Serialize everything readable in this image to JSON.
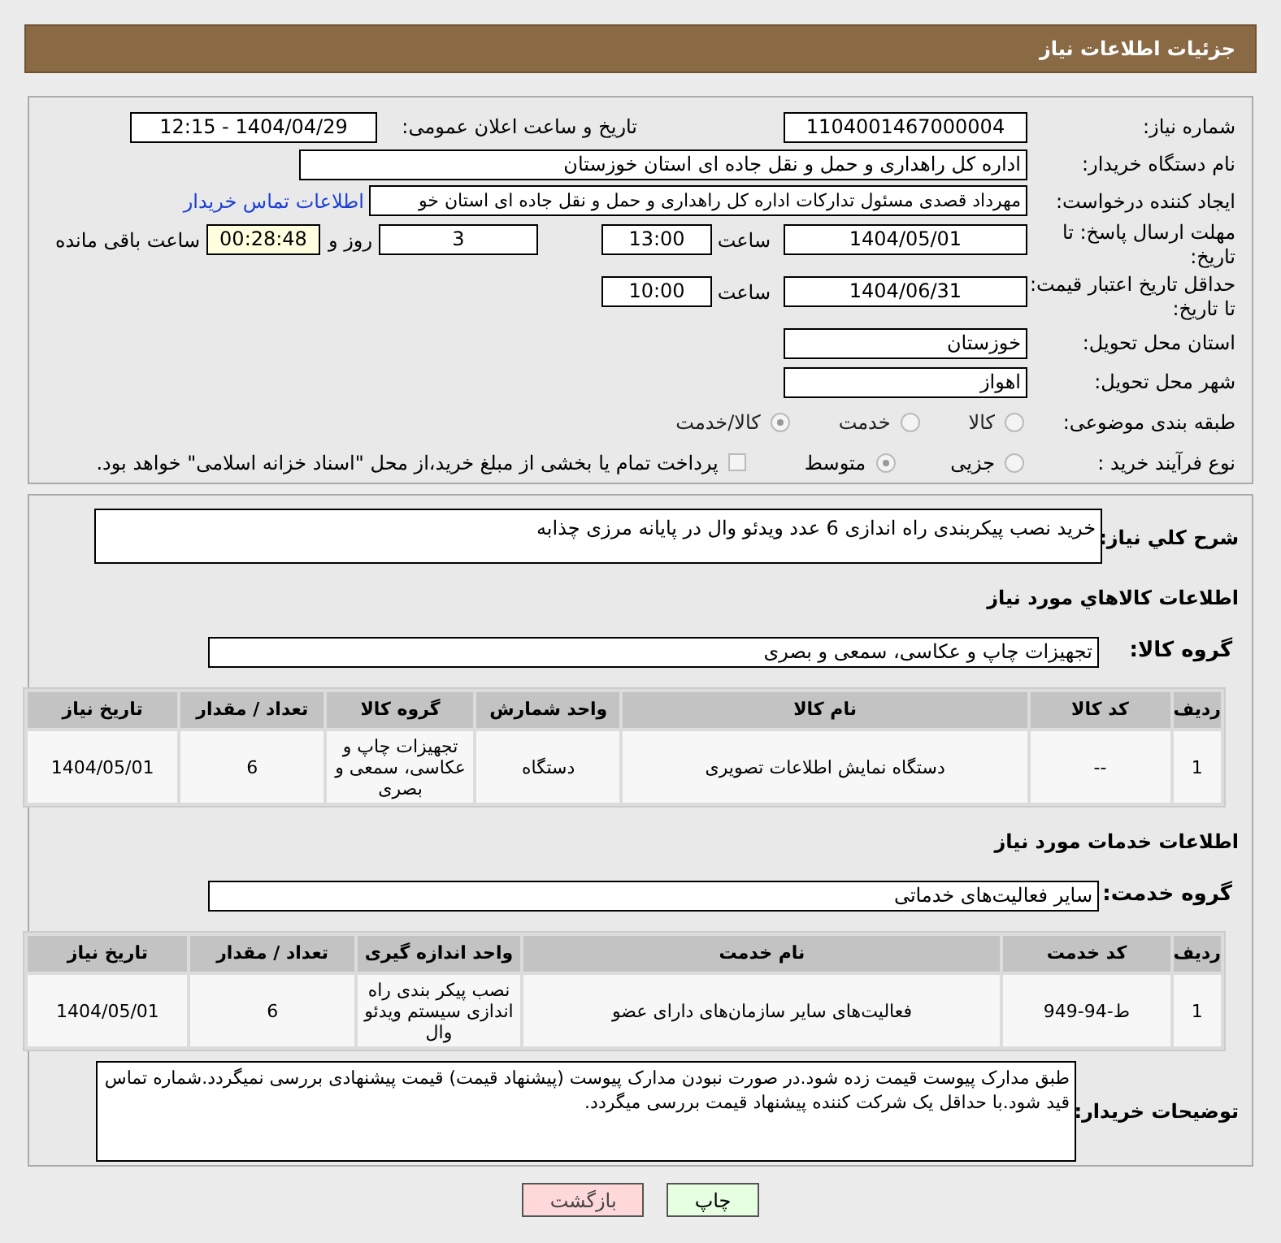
{
  "header": {
    "title": "جزئیات اطلاعات نیاز"
  },
  "need_number": {
    "label": "شماره نیاز:",
    "value": "1104001467000004"
  },
  "announce": {
    "label": "تاریخ و ساعت اعلان عمومی:",
    "value": "1404/04/29 - 12:15"
  },
  "buyer_org": {
    "label": "نام دستگاه خریدار:",
    "value": "اداره کل راهداری و حمل و نقل جاده ای استان خوزستان"
  },
  "creator": {
    "label": "ایجاد کننده درخواست:",
    "value": "مهرداد قصدی مسئول تدارکات اداره کل راهداری و حمل و نقل جاده ای استان خو",
    "link": "اطلاعات تماس خریدار"
  },
  "deadline": {
    "label": "مهلت ارسال پاسخ: تا تاریخ:",
    "date": "1404/05/01",
    "time_label": "ساعت",
    "time": "13:00",
    "days": "3",
    "days_label": "روز و",
    "remaining": "00:28:48",
    "remaining_label": "ساعت باقی مانده"
  },
  "validity": {
    "label": "حداقل تاریخ اعتبار قیمت: تا تاریخ:",
    "date": "1404/06/31",
    "time_label": "ساعت",
    "time": "10:00"
  },
  "province": {
    "label": "استان محل تحویل:",
    "value": "خوزستان"
  },
  "city": {
    "label": "شهر محل تحویل:",
    "value": "اهواز"
  },
  "category": {
    "label": "طبقه بندی موضوعی:",
    "options": [
      {
        "label": "کالا",
        "selected": false
      },
      {
        "label": "خدمت",
        "selected": false
      },
      {
        "label": "کالا/خدمت",
        "selected": true
      }
    ]
  },
  "purchase_type": {
    "label": "نوع فرآیند خرید :",
    "options": [
      {
        "label": "جزیی",
        "selected": false
      },
      {
        "label": "متوسط",
        "selected": true
      }
    ],
    "payment_checkbox": {
      "label": "پرداخت تمام یا بخشی از مبلغ خرید،از محل \"اسناد خزانه اسلامی\" خواهد بود.",
      "checked": false
    }
  },
  "description": {
    "label": "شرح كلي نياز:",
    "value": "خرید نصب پیکربندی راه اندازی 6 عدد ویدئو وال در پایانه مرزی چذابه"
  },
  "goods": {
    "heading": "اطلاعات کالاهاي مورد نياز",
    "group_label": "گروه کالا:",
    "group": "تجهیزات چاپ و عکاسی، سمعی و بصری",
    "columns": [
      "ردیف",
      "کد کالا",
      "نام کالا",
      "واحد شمارش",
      "گروه کالا",
      "تعداد / مقدار",
      "تاریخ نیاز"
    ],
    "rows": [
      [
        "1",
        "--",
        "دستگاه نمایش اطلاعات تصویری",
        "دستگاه",
        "تجهیزات چاپ و عکاسی، سمعی و بصری",
        "6",
        "1404/05/01"
      ]
    ]
  },
  "services": {
    "heading": "اطلاعات خدمات مورد نياز",
    "group_label": "گروه خدمت:",
    "group": "سایر فعالیت‌های خدماتی",
    "columns": [
      "ردیف",
      "کد خدمت",
      "نام خدمت",
      "واحد اندازه گیری",
      "تعداد / مقدار",
      "تاریخ نیاز"
    ],
    "rows": [
      [
        "1",
        "ط-94-949",
        "فعالیت‌های سایر سازمان‌های دارای عضو",
        "نصب پیکر بندی راه اندازی سیستم ویدئو وال",
        "6",
        "1404/05/01"
      ]
    ]
  },
  "buyer_notes": {
    "label": "توضیحات خریدار:",
    "value": "طبق مدارک پیوست قیمت زده شود.در صورت نبودن مدارک پیوست (پیشنهاد قیمت) قیمت پیشنهادی بررسی نمیگردد.شماره تماس قید شود.با حداقل یک شرکت کننده پیشنهاد قیمت بررسی میگردد."
  },
  "buttons": [
    {
      "label": "چاپ",
      "kind": "print"
    },
    {
      "label": "بازگشت",
      "kind": "back"
    }
  ]
}
